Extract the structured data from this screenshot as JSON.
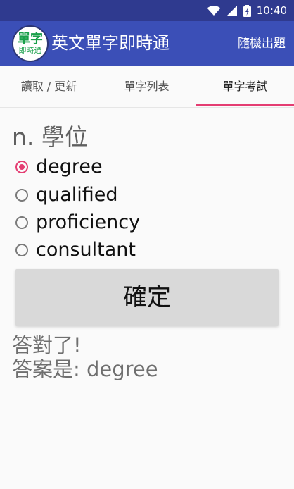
{
  "status_bar": {
    "time": "10:40"
  },
  "app_bar": {
    "logo_line1": "單字",
    "logo_line2": "即時通",
    "title": "英文單字即時通",
    "action": "隨機出題"
  },
  "tabs": [
    {
      "label": "讀取 / 更新"
    },
    {
      "label": "單字列表"
    },
    {
      "label": "單字考試"
    }
  ],
  "quiz": {
    "question": "n. 學位",
    "options": [
      {
        "label": "degree",
        "selected": true
      },
      {
        "label": "qualified",
        "selected": false
      },
      {
        "label": "proficiency",
        "selected": false
      },
      {
        "label": "consultant",
        "selected": false
      }
    ],
    "confirm_label": "確定",
    "result_line1": "答對了!",
    "result_line2": "答案是: degree"
  },
  "colors": {
    "status_bar": "#2f3a8f",
    "app_bar": "#3b4fb7",
    "accent": "#e43d72",
    "logo_text": "#1aa04a"
  }
}
